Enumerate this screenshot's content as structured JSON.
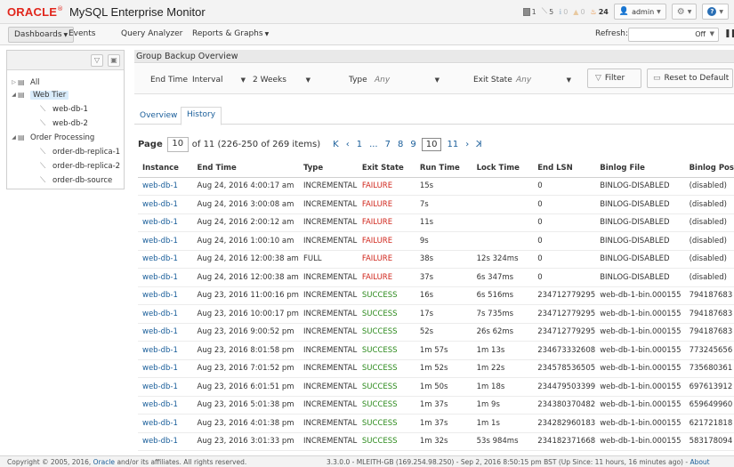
{
  "brand": {
    "oracle": "ORACLE",
    "registered": "®",
    "product": "MySQL Enterprise Monitor"
  },
  "status_counts": [
    {
      "icon": "server-icon",
      "value": "1",
      "dim": false
    },
    {
      "icon": "pulse-icon",
      "value": "5",
      "dim": false
    },
    {
      "icon": "info-icon",
      "value": "0",
      "dim": true
    },
    {
      "icon": "warning-icon",
      "value": "0",
      "dim": true
    },
    {
      "icon": "fire-icon",
      "value": "24",
      "dim": false,
      "color": "#e8730c"
    }
  ],
  "user_menu": {
    "label": "admin"
  },
  "nav": {
    "dashboards": "Dashboards",
    "events": "Events",
    "query_analyzer": "Query Analyzer",
    "reports": "Reports & Graphs",
    "refresh_label": "Refresh:",
    "refresh_value": "Off"
  },
  "sidebar": {
    "items": [
      {
        "label": "All",
        "type": "group",
        "level": 0
      },
      {
        "label": "Web Tier",
        "type": "group",
        "level": 0,
        "selected": true
      },
      {
        "label": "web-db-1",
        "type": "server",
        "level": 1
      },
      {
        "label": "web-db-2",
        "type": "server",
        "level": 1
      },
      {
        "label": "Order Processing",
        "type": "group",
        "level": 0
      },
      {
        "label": "order-db-replica-1",
        "type": "server",
        "level": 1
      },
      {
        "label": "order-db-replica-2",
        "type": "server",
        "level": 1
      },
      {
        "label": "order-db-source",
        "type": "server",
        "level": 1
      }
    ]
  },
  "main": {
    "title": "Group Backup Overview",
    "filters": {
      "end_time_label": "End Time",
      "interval_value": "Interval",
      "range_value": "2 Weeks",
      "type_label": "Type",
      "type_value": "Any",
      "exit_state_label": "Exit State",
      "exit_state_value": "Any",
      "filter_button": "Filter",
      "reset_button": "Reset to Default"
    },
    "tabs": [
      "Overview",
      "History"
    ],
    "active_tab": "History",
    "pager": {
      "label": "Page",
      "current": "10",
      "of_text": "of 11 (226-250 of 269 items)",
      "first": "K",
      "prev": "‹",
      "pages": [
        "1",
        "...",
        "7",
        "8",
        "9",
        "10",
        "11"
      ],
      "next": "›",
      "last": "K"
    },
    "table": {
      "columns": [
        "Instance",
        "End Time",
        "Type",
        "Exit State",
        "Run Time",
        "Lock Time",
        "End LSN",
        "Binlog File",
        "Binlog Pos"
      ],
      "rows": [
        [
          "web-db-1",
          "Aug 24, 2016 4:00:17 am",
          "INCREMENTAL",
          "FAILURE",
          "15s",
          "",
          "0",
          "BINLOG-DISABLED",
          "(disabled)"
        ],
        [
          "web-db-1",
          "Aug 24, 2016 3:00:08 am",
          "INCREMENTAL",
          "FAILURE",
          "7s",
          "",
          "0",
          "BINLOG-DISABLED",
          "(disabled)"
        ],
        [
          "web-db-1",
          "Aug 24, 2016 2:00:12 am",
          "INCREMENTAL",
          "FAILURE",
          "11s",
          "",
          "0",
          "BINLOG-DISABLED",
          "(disabled)"
        ],
        [
          "web-db-1",
          "Aug 24, 2016 1:00:10 am",
          "INCREMENTAL",
          "FAILURE",
          "9s",
          "",
          "0",
          "BINLOG-DISABLED",
          "(disabled)"
        ],
        [
          "web-db-1",
          "Aug 24, 2016 12:00:38 am",
          "FULL",
          "FAILURE",
          "38s",
          "12s 324ms",
          "0",
          "BINLOG-DISABLED",
          "(disabled)"
        ],
        [
          "web-db-1",
          "Aug 24, 2016 12:00:38 am",
          "INCREMENTAL",
          "FAILURE",
          "37s",
          "6s 347ms",
          "0",
          "BINLOG-DISABLED",
          "(disabled)"
        ],
        [
          "web-db-1",
          "Aug 23, 2016 11:00:16 pm",
          "INCREMENTAL",
          "SUCCESS",
          "16s",
          "6s 516ms",
          "234712779295",
          "web-db-1-bin.000155",
          "794187683"
        ],
        [
          "web-db-1",
          "Aug 23, 2016 10:00:17 pm",
          "INCREMENTAL",
          "SUCCESS",
          "17s",
          "7s 735ms",
          "234712779295",
          "web-db-1-bin.000155",
          "794187683"
        ],
        [
          "web-db-1",
          "Aug 23, 2016 9:00:52 pm",
          "INCREMENTAL",
          "SUCCESS",
          "52s",
          "26s 62ms",
          "234712779295",
          "web-db-1-bin.000155",
          "794187683"
        ],
        [
          "web-db-1",
          "Aug 23, 2016 8:01:58 pm",
          "INCREMENTAL",
          "SUCCESS",
          "1m 57s",
          "1m 13s",
          "234673332608",
          "web-db-1-bin.000155",
          "773245656"
        ],
        [
          "web-db-1",
          "Aug 23, 2016 7:01:52 pm",
          "INCREMENTAL",
          "SUCCESS",
          "1m 52s",
          "1m 22s",
          "234578536505",
          "web-db-1-bin.000155",
          "735680361"
        ],
        [
          "web-db-1",
          "Aug 23, 2016 6:01:51 pm",
          "INCREMENTAL",
          "SUCCESS",
          "1m 50s",
          "1m 18s",
          "234479503399",
          "web-db-1-bin.000155",
          "697613912"
        ],
        [
          "web-db-1",
          "Aug 23, 2016 5:01:38 pm",
          "INCREMENTAL",
          "SUCCESS",
          "1m 37s",
          "1m 9s",
          "234380370482",
          "web-db-1-bin.000155",
          "659649960"
        ],
        [
          "web-db-1",
          "Aug 23, 2016 4:01:38 pm",
          "INCREMENTAL",
          "SUCCESS",
          "1m 37s",
          "1m 1s",
          "234282960183",
          "web-db-1-bin.000155",
          "621721818"
        ],
        [
          "web-db-1",
          "Aug 23, 2016 3:01:33 pm",
          "INCREMENTAL",
          "SUCCESS",
          "1m 32s",
          "53s 984ms",
          "234182371668",
          "web-db-1-bin.000155",
          "583178094"
        ]
      ]
    }
  },
  "footer": {
    "copyright_pre": "Copyright © 2005, 2016,",
    "oracle_link": "Oracle",
    "copyright_post": "and/or its affiliates. All rights reserved.",
    "version_info": "3.3.0.0 - MLEITH-GB (169.254.98.250) - Sep 2, 2016 8:50:15 pm BST (Up Since: 11 hours, 16 minutes ago) -",
    "about_link": "About"
  },
  "colors": {
    "failure": "#d0271d",
    "success": "#2c8a1c",
    "link": "#1a5e9a",
    "oracle_red": "#e1261c"
  }
}
